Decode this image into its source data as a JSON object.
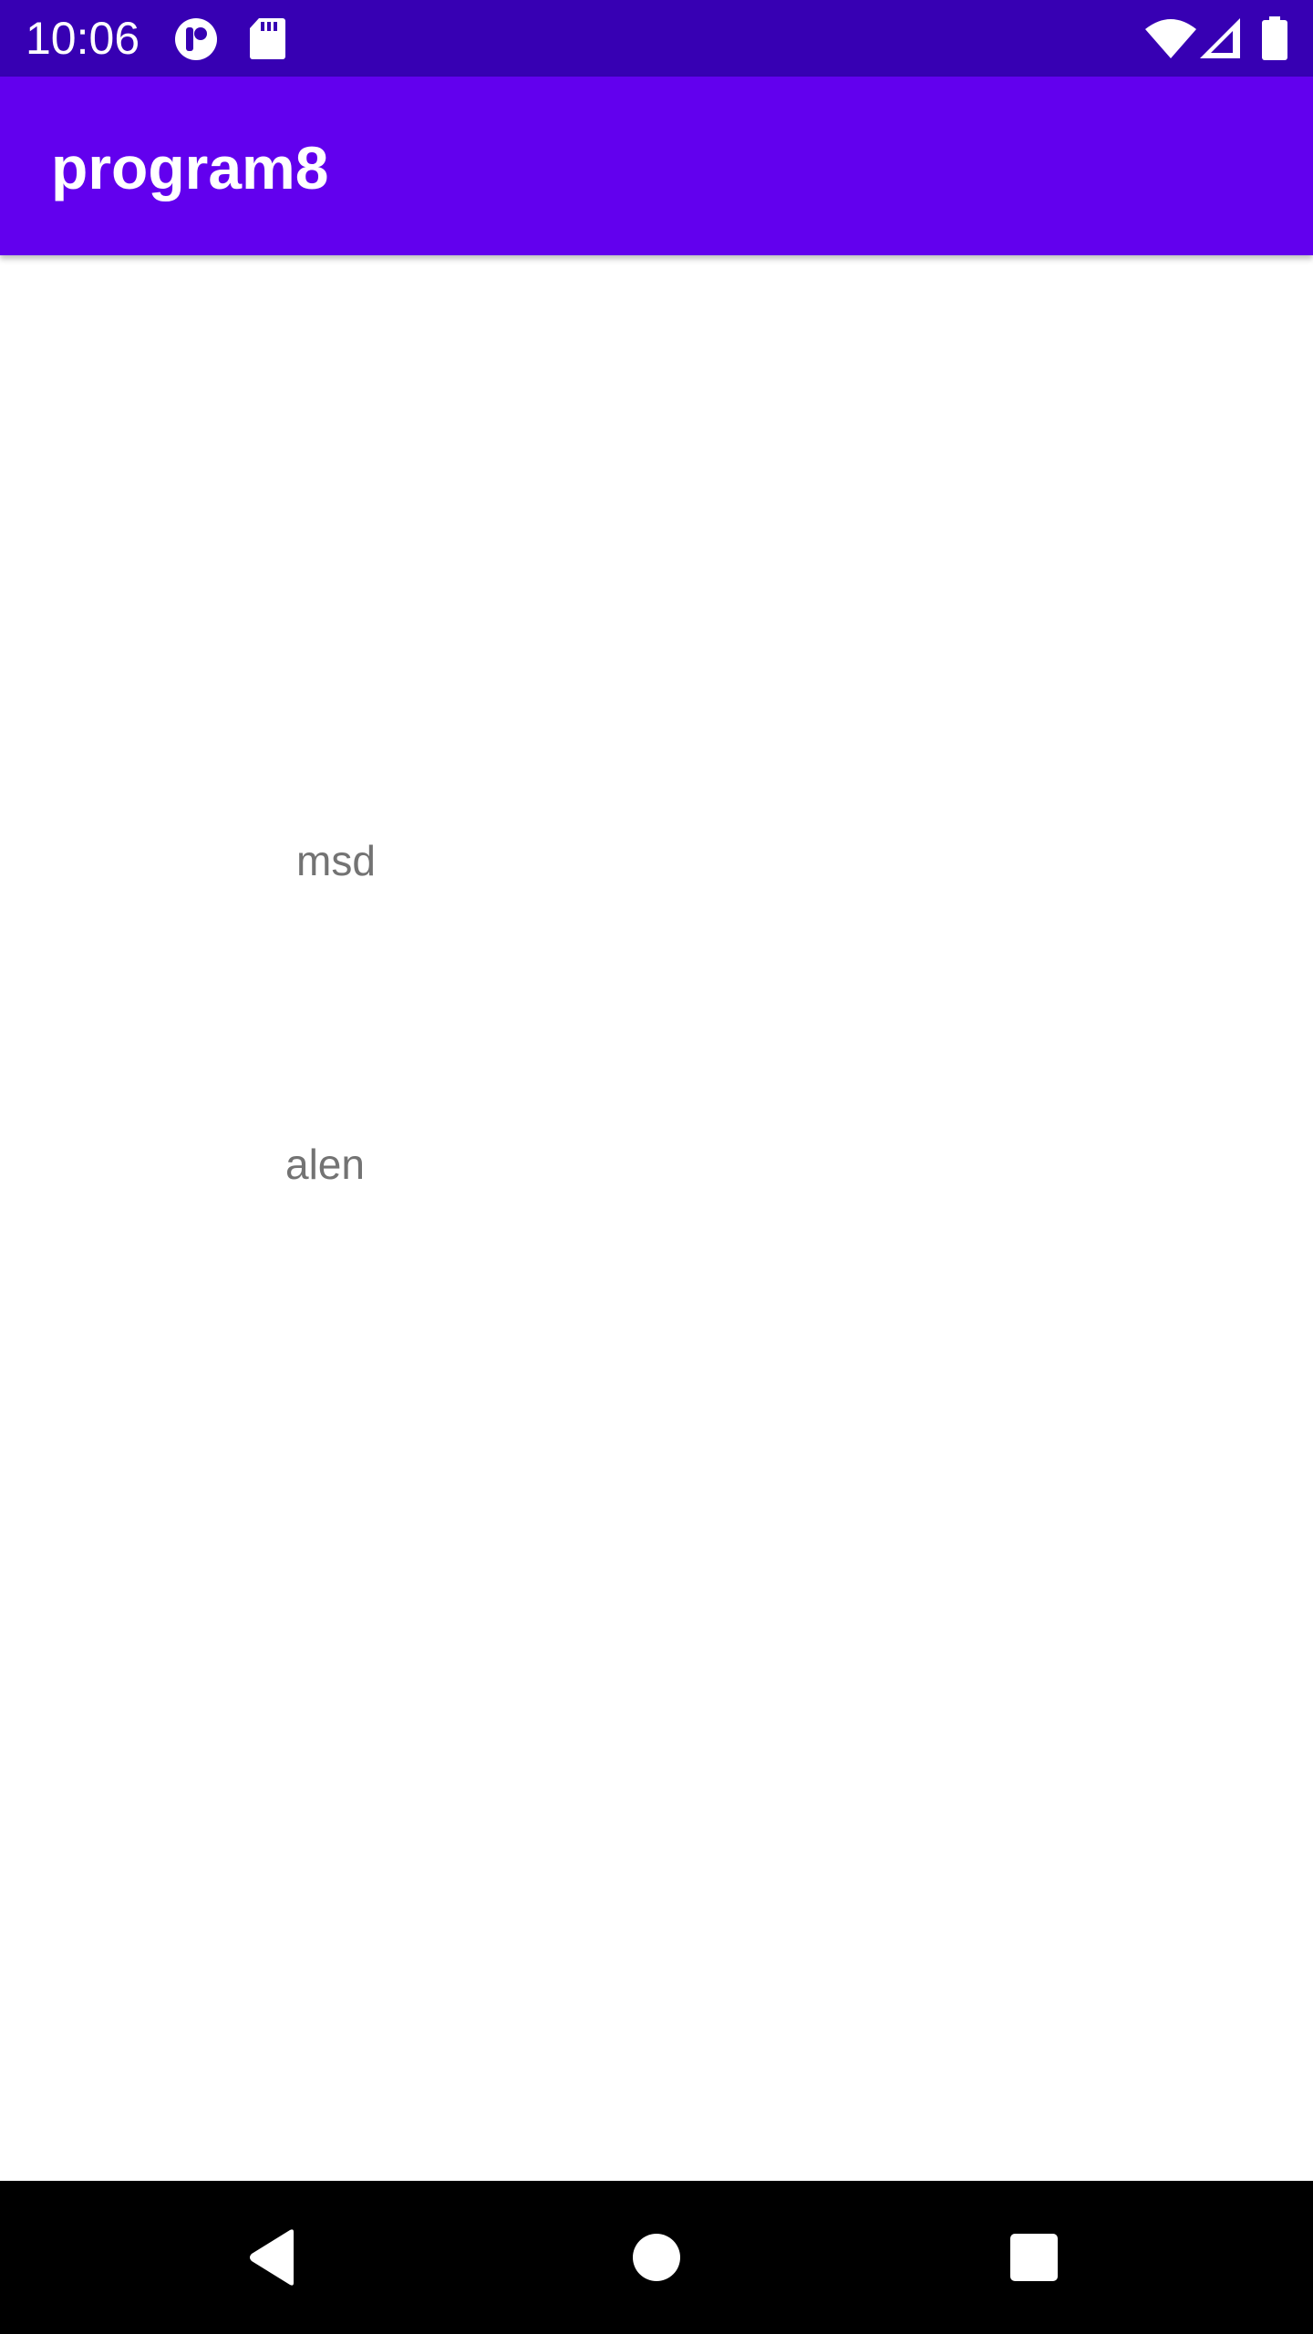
{
  "status_bar": {
    "time": "10:06",
    "left_icons": [
      "app-notification-icon",
      "sd-card-icon"
    ],
    "right_icons": [
      "wifi-icon",
      "cellular-signal-icon",
      "battery-icon"
    ],
    "color": "#3700b3"
  },
  "app_bar": {
    "title": "program8",
    "color": "#6200ee"
  },
  "content": {
    "items": [
      {
        "text": "msd"
      },
      {
        "text": "alen"
      }
    ],
    "text_color": "#737373"
  },
  "nav_bar": {
    "buttons": [
      "back-icon",
      "home-icon",
      "recents-icon"
    ],
    "color": "#000000"
  }
}
